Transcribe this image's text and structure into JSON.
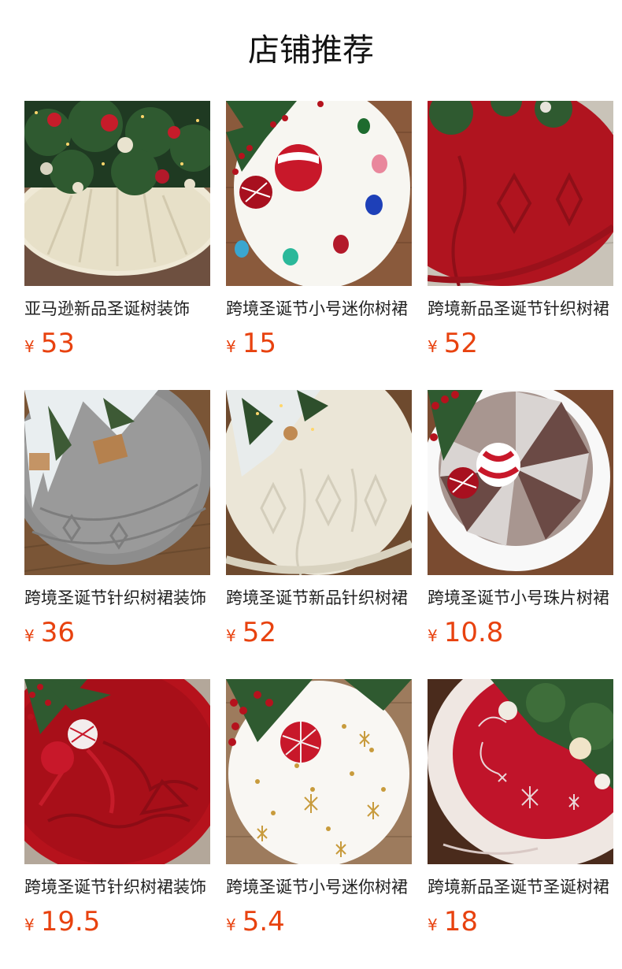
{
  "page": {
    "title": "店铺推荐"
  },
  "colors": {
    "price": "#e8420f",
    "title": "#111111",
    "name": "#222222"
  },
  "products": [
    {
      "name": "亚马逊新品圣诞树装饰",
      "currency": "¥",
      "price": "53",
      "image": "ivory-knit-tree-skirt"
    },
    {
      "name": "跨境圣诞节小号迷你树裙",
      "currency": "¥",
      "price": "15",
      "image": "white-paw-print-tree-skirt"
    },
    {
      "name": "跨境新品圣诞节针织树裙",
      "currency": "¥",
      "price": "52",
      "image": "red-cable-knit-tree-skirt"
    },
    {
      "name": "跨境圣诞节针织树裙装饰",
      "currency": "¥",
      "price": "36",
      "image": "grey-knit-tree-skirt"
    },
    {
      "name": "跨境圣诞节新品针织树裙",
      "currency": "¥",
      "price": "52",
      "image": "cream-cable-knit-tree-skirt"
    },
    {
      "name": "跨境圣诞节小号珠片树裙",
      "currency": "¥",
      "price": "10.8",
      "image": "sequin-plush-tree-skirt"
    },
    {
      "name": "跨境圣诞节针织树裙装饰",
      "currency": "¥",
      "price": "19.5",
      "image": "red-bow-knit-tree-skirt"
    },
    {
      "name": "跨境圣诞节小号迷你树裙",
      "currency": "¥",
      "price": "5.4",
      "image": "white-snowflake-plush-tree-skirt"
    },
    {
      "name": "跨境新品圣诞节圣诞树裙",
      "currency": "¥",
      "price": "18",
      "image": "red-snowflake-embroidered-tree-skirt"
    }
  ]
}
